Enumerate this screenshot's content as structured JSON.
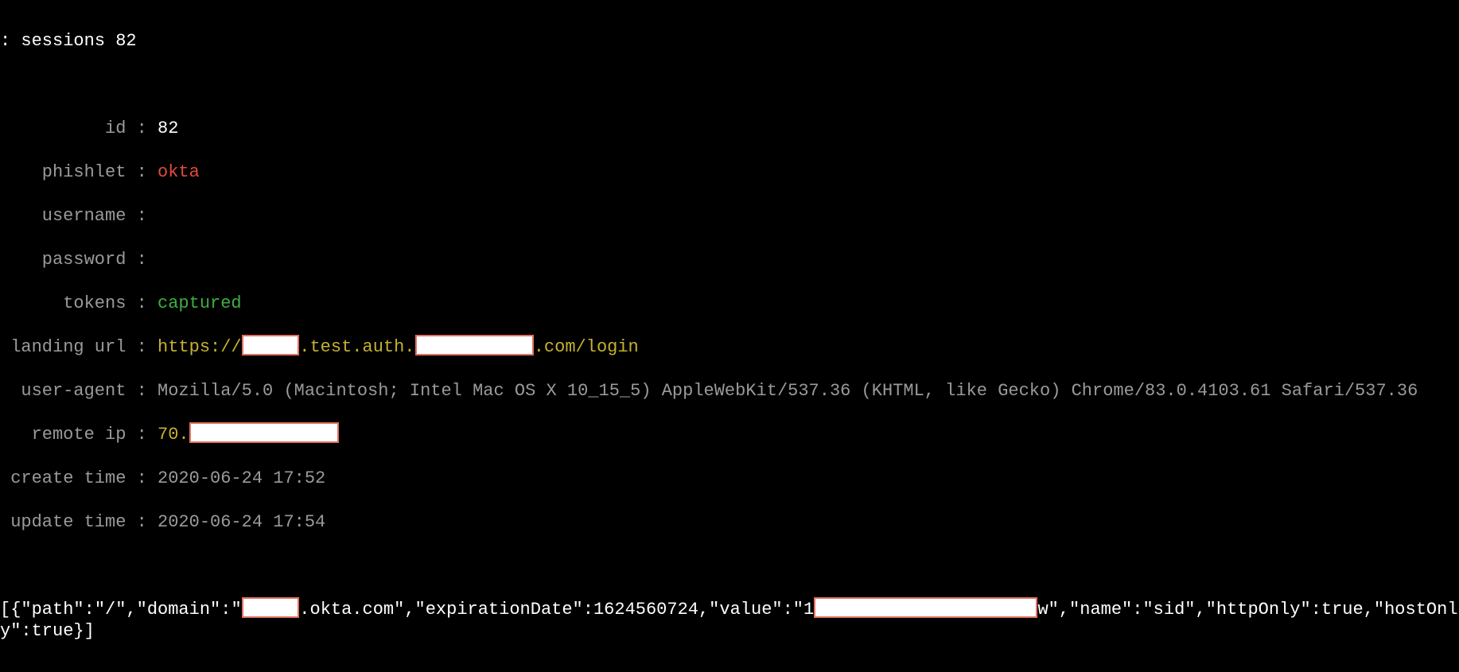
{
  "header": {
    "prompt": ":",
    "command": "sessions",
    "arg": "82"
  },
  "fields": {
    "id_label": "id",
    "id_value": "82",
    "phishlet_label": "phishlet",
    "phishlet_value": "okta",
    "username_label": "username",
    "username_value": "",
    "password_label": "password",
    "password_value": "",
    "tokens_label": "tokens",
    "tokens_value": "captured",
    "landing_label": "landing url",
    "landing_prefix": "https://",
    "landing_mid": ".test.auth.",
    "landing_suffix": ".com/login",
    "ua_label": "user-agent",
    "ua_value": "Mozilla/5.0 (Macintosh; Intel Mac OS X 10_15_5) AppleWebKit/537.36 (KHTML, like Gecko) Chrome/83.0.4103.61 Safari/537.36",
    "ip_label": "remote ip",
    "ip_prefix": "70.",
    "create_label": "create time",
    "create_value": "2020-06-24 17:52",
    "update_label": "update time",
    "update_value": "2020-06-24 17:54"
  },
  "cookie": {
    "p1": "[{\"path\":\"/\",\"domain\":\"",
    "p2": ".okta.com\",\"expirationDate\":1624560724,\"value\":\"1",
    "p3": "w\",\"name\":\"sid\",\"httpOnly\":true,\"hostOnly\":true}]"
  }
}
